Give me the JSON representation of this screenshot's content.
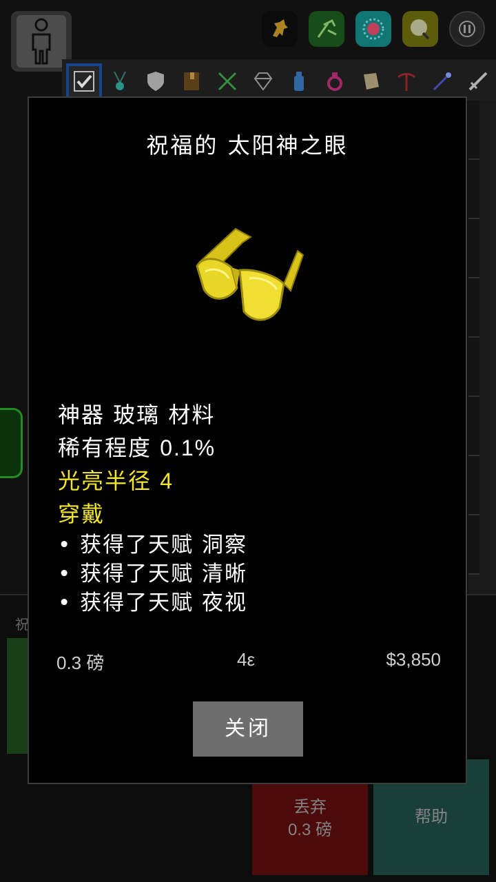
{
  "hud": {
    "icons": [
      {
        "name": "horse-icon",
        "bg": "#0e0e0e"
      },
      {
        "name": "crafting-icon",
        "bg": "#1d5a1d"
      },
      {
        "name": "settings-icon",
        "bg": "#138a8a"
      },
      {
        "name": "map-icon",
        "bg": "#6d6d10"
      },
      {
        "name": "pause-icon",
        "bg": "#2a2a2a"
      }
    ]
  },
  "tabs": [
    "check-icon",
    "amulet-icon",
    "shield-icon",
    "book-icon",
    "cutlery-icon",
    "gem-icon",
    "potion-icon",
    "ring-icon",
    "scroll-icon",
    "pickaxe-icon",
    "wand-icon",
    "sword-icon"
  ],
  "background": {
    "left_label": "祝",
    "drop_button": {
      "label": "丢弃",
      "weight": "0.3 磅"
    },
    "help_button": {
      "label": "帮助"
    }
  },
  "item": {
    "title": "祝福的 太阳神之眼",
    "art": "golden-sunglasses",
    "accent": "#f2e52a",
    "tags": "神器 玻璃 材料",
    "rarity_label": "稀有程度",
    "rarity_value": "0.1%",
    "light_label": "光亮半径",
    "light_value": "4",
    "wear_label": "穿戴",
    "bullets": [
      "获得了天赋 洞察",
      "获得了天赋 清晰",
      "获得了天赋 夜视"
    ],
    "weight": "0.3 磅",
    "energy": "4ε",
    "price": "$3,850"
  },
  "modal": {
    "close_label": "关闭"
  }
}
